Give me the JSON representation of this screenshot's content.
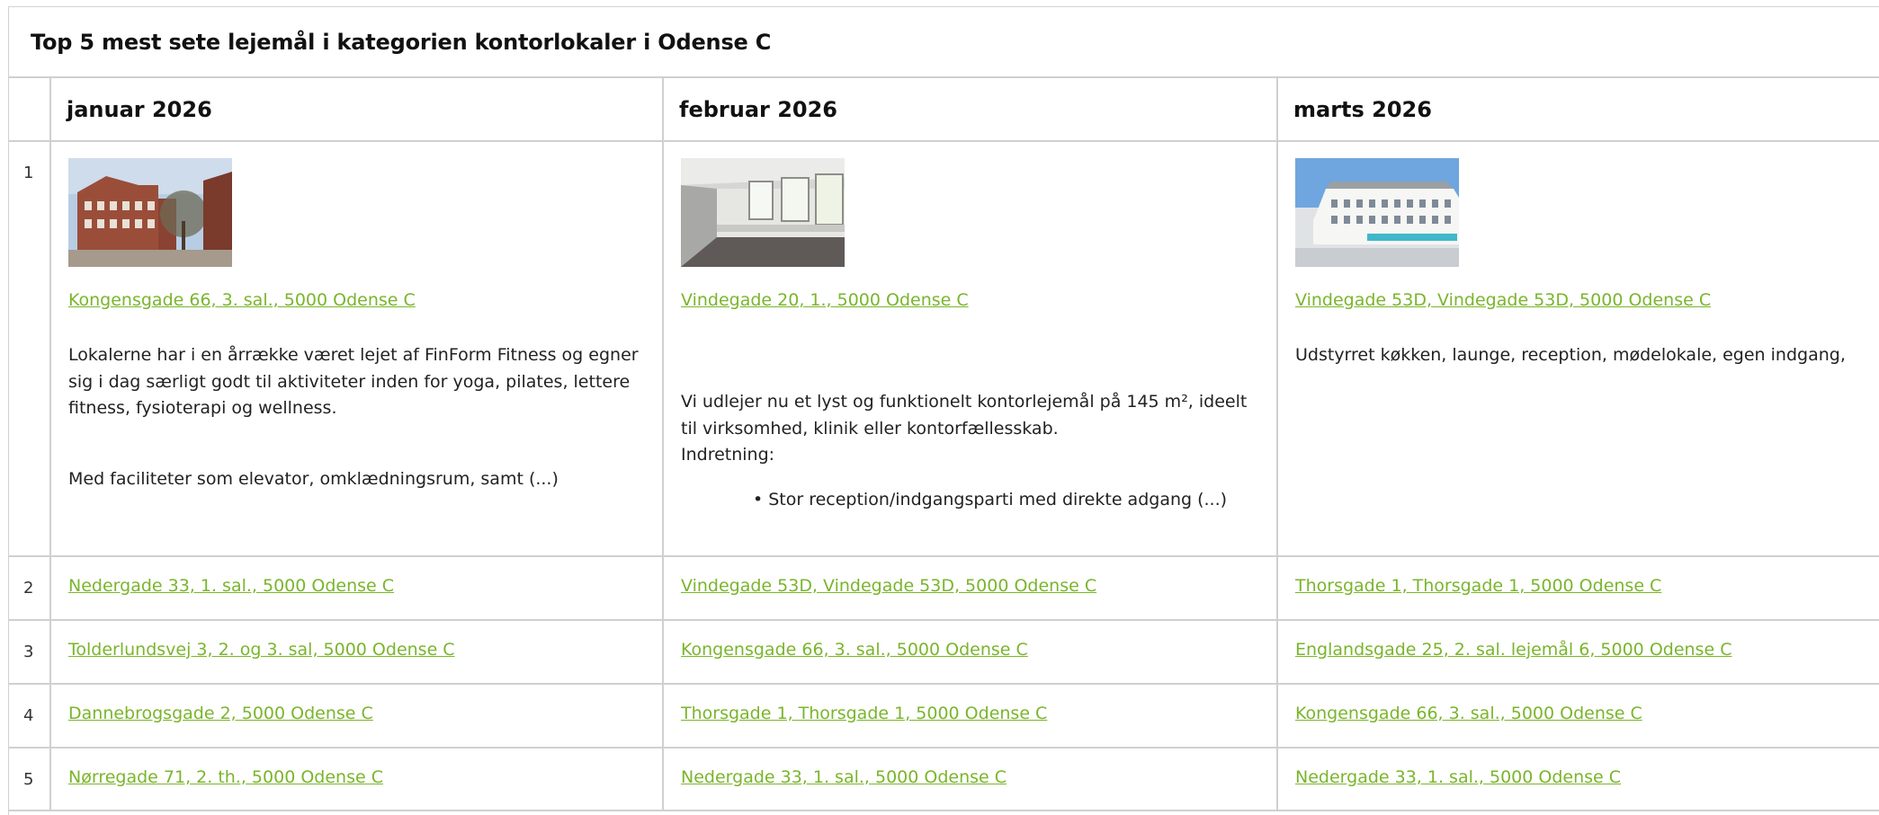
{
  "title": "Top 5 mest sete lejemål i kategorien kontorlokaler i Odense C",
  "months": [
    "januar 2026",
    "februar 2026",
    "marts 2026"
  ],
  "rows": [
    {
      "rank": "1",
      "cells": [
        {
          "image": "office-building-photo",
          "link": "Kongensgade 66, 3. sal., 5000 Odense C",
          "paragraphs": [
            "Lokalerne har i en årrække været lejet af FinForm Fitness og egner sig i dag særligt godt til aktiviteter inden for yoga, pilates, lettere fitness, fysioterapi og wellness.",
            "Med faciliteter som elevator, omklædningsrum, samt (...)"
          ]
        },
        {
          "image": "empty-office-room-photo",
          "link": "Vindegade 20, 1., 5000 Odense C",
          "text_a": "Vi udlejer nu et lyst og funktionelt kontorlejemål på 145 m², ideelt til virksomhed, klinik eller kontorfællesskab.",
          "text_b": "Indretning:",
          "bullet": "Stor reception/indgangsparti med direkte adgang (...)"
        },
        {
          "image": "white-building-photo",
          "link": "Vindegade 53D, Vindegade 53D, 5000 Odense C",
          "paragraph": "Udstyrret køkken, launge, reception, mødelokale, egen indgang,"
        }
      ]
    },
    {
      "rank": "2",
      "links": [
        "Nedergade 33, 1. sal., 5000 Odense C",
        "Vindegade 53D, Vindegade 53D, 5000 Odense C",
        "Thorsgade 1, Thorsgade 1, 5000 Odense C"
      ]
    },
    {
      "rank": "3",
      "links": [
        "Tolderlundsvej 3, 2. og 3. sal, 5000 Odense C",
        "Kongensgade 66, 3. sal., 5000 Odense C",
        "Englandsgade 25, 2. sal. lejemål 6, 5000 Odense C"
      ]
    },
    {
      "rank": "4",
      "links": [
        "Dannebrogsgade 2, 5000 Odense C",
        "Thorsgade 1, Thorsgade 1, 5000 Odense C",
        "Kongensgade 66, 3. sal., 5000 Odense C"
      ]
    },
    {
      "rank": "5",
      "links": [
        "Nørregade 71, 2. th., 5000 Odense C",
        "Nedergade 33, 1. sal., 5000 Odense C",
        "Nedergade 33, 1. sal., 5000 Odense C"
      ]
    }
  ],
  "colors": {
    "link": "#7ab52c",
    "border": "#d0d0d0"
  }
}
